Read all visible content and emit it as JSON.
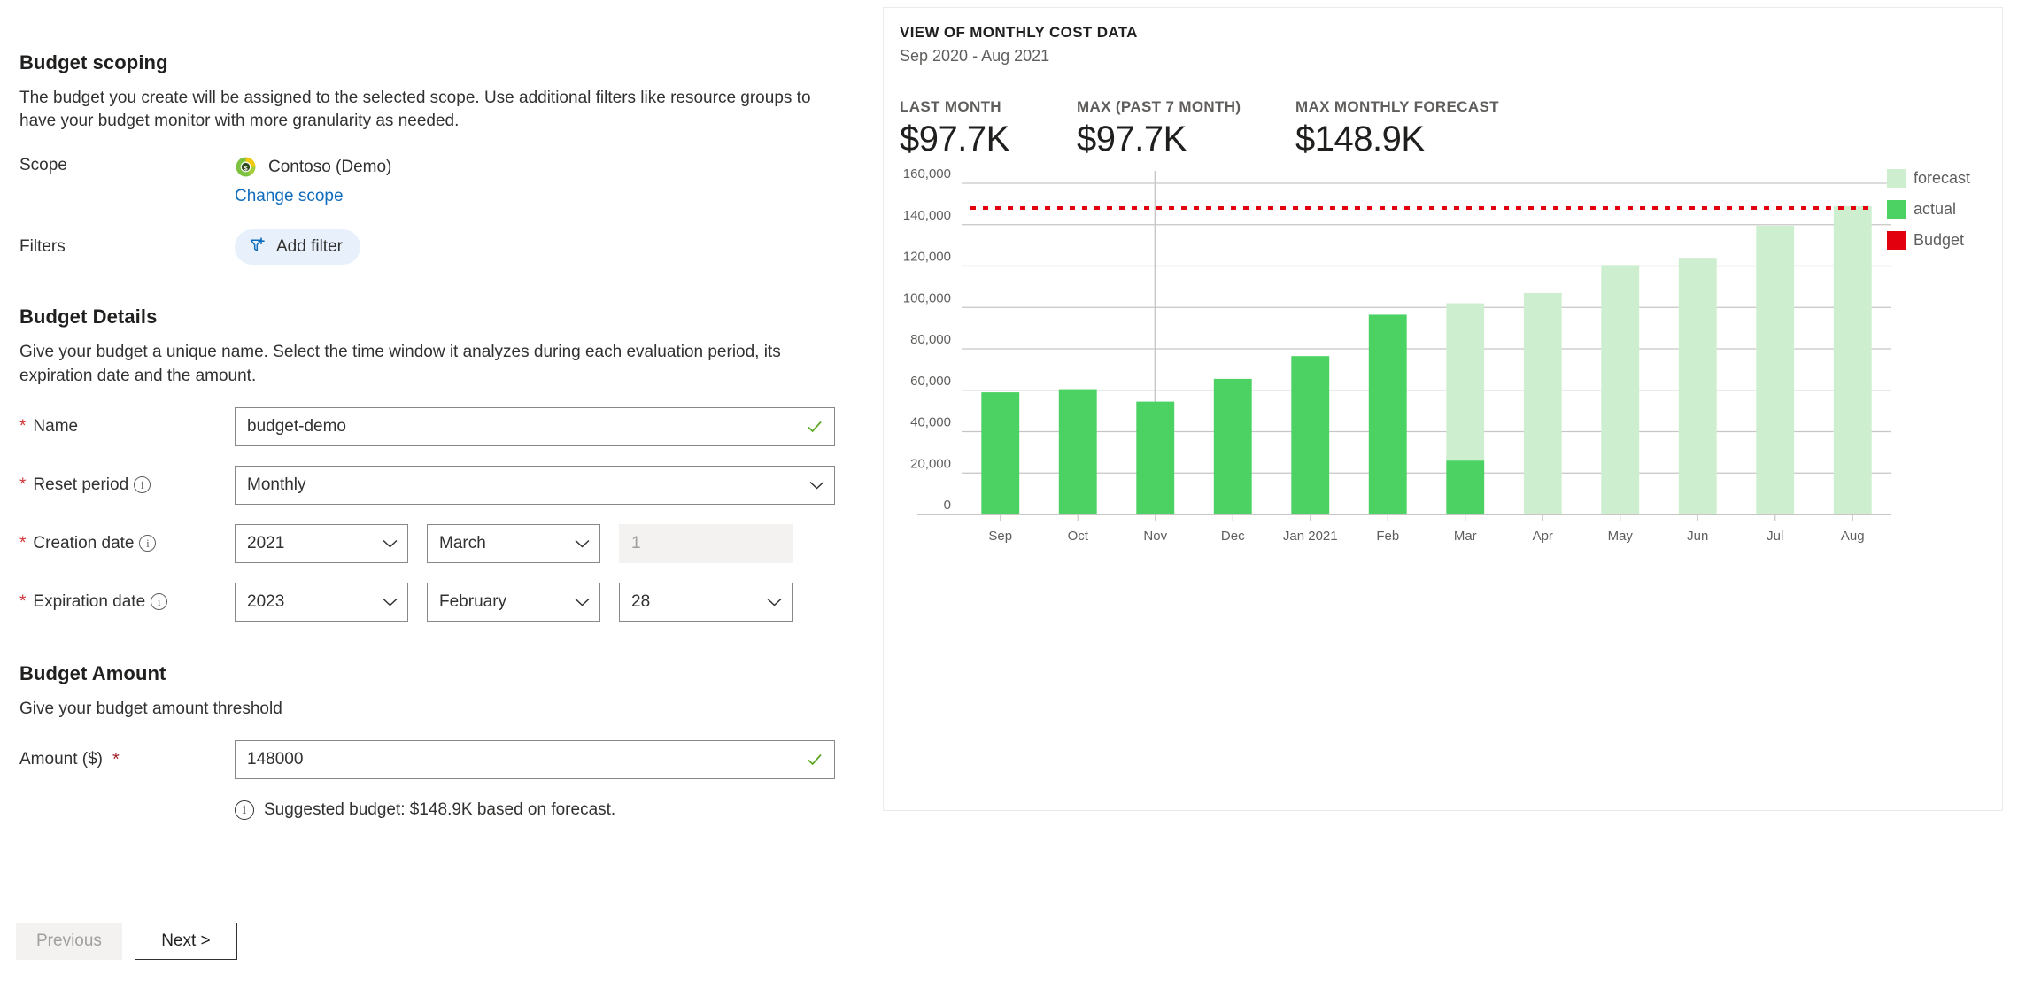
{
  "scoping": {
    "heading": "Budget scoping",
    "description": "The budget you create will be assigned to the selected scope. Use additional filters like resource groups to have your budget monitor with more granularity as needed.",
    "scope_label": "Scope",
    "scope_value": "Contoso (Demo)",
    "change_scope_link": "Change scope",
    "filters_label": "Filters",
    "add_filter_label": "Add filter"
  },
  "details": {
    "heading": "Budget Details",
    "description": "Give your budget a unique name. Select the time window it analyzes during each evaluation period, its expiration date and the amount.",
    "name_label": "Name",
    "name_value": "budget-demo",
    "reset_label": "Reset period",
    "reset_value": "Monthly",
    "creation_label": "Creation date",
    "creation_year": "2021",
    "creation_month": "March",
    "creation_day": "1",
    "expiration_label": "Expiration date",
    "expiration_year": "2023",
    "expiration_month": "February",
    "expiration_day": "28"
  },
  "amount": {
    "heading": "Budget Amount",
    "description": "Give your budget amount threshold",
    "label": "Amount ($)",
    "value": "148000",
    "suggestion": "Suggested budget: $148.9K based on forecast."
  },
  "footer": {
    "previous_label": "Previous",
    "next_label": "Next >"
  },
  "chart_panel": {
    "title": "VIEW OF MONTHLY COST DATA",
    "subtitle": "Sep 2020 - Aug 2021",
    "kpis": [
      {
        "label": "LAST MONTH",
        "value": "$97.7K"
      },
      {
        "label": "MAX (PAST 7 MONTH)",
        "value": "$97.7K"
      },
      {
        "label": "MAX MONTHLY FORECAST",
        "value": "$148.9K"
      }
    ]
  },
  "colors": {
    "actual": "#4cd263",
    "forecast": "#cdeecf",
    "budget": "#e2000f",
    "link": "#0f6cbd",
    "gridline": "#c8c6c4",
    "axis_text": "#605e5c"
  },
  "chart_data": {
    "type": "bar",
    "title": "VIEW OF MONTHLY COST DATA",
    "subtitle": "Sep 2020 - Aug 2021",
    "xlabel": "",
    "ylabel": "",
    "ylim": [
      0,
      160000
    ],
    "ytick_step": 20000,
    "yticks": [
      "0",
      "20,000",
      "40,000",
      "60,000",
      "80,000",
      "100,000",
      "120,000",
      "140,000",
      "160,000"
    ],
    "grid": true,
    "legend_position": "right",
    "stacked": true,
    "categories": [
      "Sep",
      "Oct",
      "Nov",
      "Dec",
      "Jan 2021",
      "Feb",
      "Mar",
      "Apr",
      "May",
      "Jun",
      "Jul",
      "Aug"
    ],
    "series": [
      {
        "name": "actual",
        "color": "#4cd263",
        "values": [
          59000,
          60500,
          54500,
          65500,
          76500,
          96500,
          26000,
          null,
          null,
          null,
          null,
          null
        ]
      },
      {
        "name": "forecast",
        "color": "#cdeecf",
        "values": [
          null,
          null,
          null,
          null,
          null,
          null,
          102000,
          107000,
          120500,
          124000,
          139500,
          148900
        ]
      }
    ],
    "threshold_line": {
      "name": "Budget",
      "value": 148000,
      "color": "#e2000f",
      "style": "dotted"
    },
    "divider_line": {
      "after_category": "Nov",
      "color": "#c8c6c4"
    }
  },
  "legend": [
    {
      "label": "forecast",
      "color": "#cdeecf"
    },
    {
      "label": "actual",
      "color": "#4cd263"
    },
    {
      "label": "Budget",
      "color": "#e2000f"
    }
  ]
}
